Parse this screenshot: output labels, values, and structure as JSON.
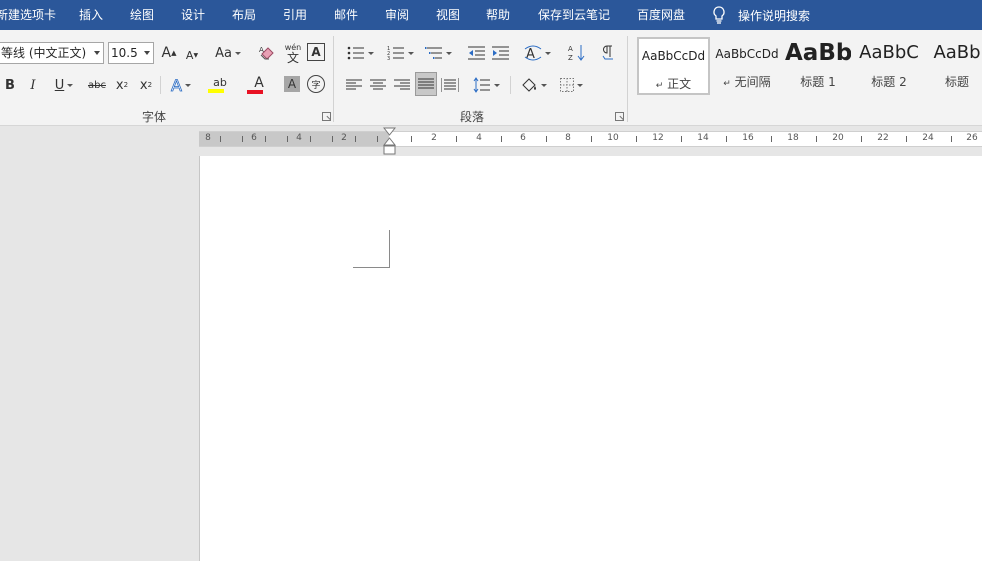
{
  "menu": {
    "tabs": [
      "新建选项卡",
      "插入",
      "绘图",
      "设计",
      "布局",
      "引用",
      "邮件",
      "审阅",
      "视图",
      "帮助",
      "保存到云笔记",
      "百度网盘"
    ],
    "tell_me": "操作说明搜索"
  },
  "font_group": {
    "font_name": "等线 (中文正文)",
    "font_size": "10.5",
    "grow_label": "A",
    "shrink_label": "A",
    "case_label": "Aa",
    "phonetic_label": "wén",
    "phonetic_char": "文",
    "border_char": "A",
    "bold": "B",
    "italic": "I",
    "underline": "U",
    "strike": "abc",
    "subscript": "x",
    "sub_mark": "2",
    "superscript": "x",
    "sup_mark": "2",
    "text_effect": "A",
    "highlight": "ab",
    "font_color": "A",
    "char_shading": "A",
    "enclose": "字",
    "label": "字体"
  },
  "paragraph_group": {
    "label": "段落"
  },
  "styles": [
    {
      "preview": "AaBbCcDd",
      "name": "正文",
      "mark": "↵"
    },
    {
      "preview": "AaBbCcDd",
      "name": "无间隔",
      "mark": "↵"
    },
    {
      "preview": "AaBb",
      "name": "标题 1"
    },
    {
      "preview": "AaBbC",
      "name": "标题 2"
    },
    {
      "preview": "AaBb",
      "name": "标题"
    }
  ],
  "ruler": {
    "left_numbers": [
      "8",
      "6",
      "4",
      "2"
    ],
    "right_numbers": [
      "2",
      "4",
      "6",
      "8",
      "10",
      "12",
      "14",
      "16",
      "18",
      "20",
      "22",
      "24",
      "26"
    ]
  },
  "colors": {
    "menubar": "#2b579a",
    "highlight_yellow": "#ffff00",
    "font_red": "#e81123",
    "text_effect_blue": "#2b6cc4"
  }
}
